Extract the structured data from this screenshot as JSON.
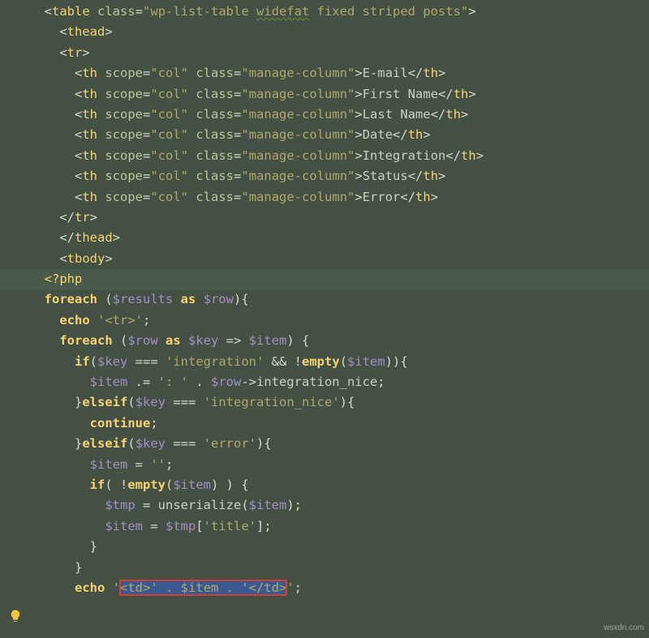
{
  "watermark": "wsxdn.com",
  "highlighted_line_index": 13,
  "selection": {
    "line_index": 28,
    "text": "<td>' . $item . '</td>"
  },
  "code_lines": [
    {
      "indent": 1,
      "tokens": [
        {
          "t": "punc",
          "v": "<"
        },
        {
          "t": "tag",
          "v": "table "
        },
        {
          "t": "attr",
          "v": "class"
        },
        {
          "t": "punc",
          "v": "="
        },
        {
          "t": "str",
          "v": "\"wp-list-table "
        },
        {
          "t": "str wavy",
          "v": "widefat"
        },
        {
          "t": "str",
          "v": " fixed striped posts\""
        },
        {
          "t": "punc",
          "v": ">"
        }
      ]
    },
    {
      "indent": 2,
      "tokens": [
        {
          "t": "punc",
          "v": "<"
        },
        {
          "t": "tag",
          "v": "thead"
        },
        {
          "t": "punc",
          "v": ">"
        }
      ]
    },
    {
      "indent": 2,
      "tokens": [
        {
          "t": "punc",
          "v": "<"
        },
        {
          "t": "tag",
          "v": "tr"
        },
        {
          "t": "punc",
          "v": ">"
        }
      ]
    },
    {
      "indent": 3,
      "tokens": [
        {
          "t": "punc",
          "v": "<"
        },
        {
          "t": "tag",
          "v": "th "
        },
        {
          "t": "attr",
          "v": "scope"
        },
        {
          "t": "punc",
          "v": "="
        },
        {
          "t": "str",
          "v": "\"col\" "
        },
        {
          "t": "attr",
          "v": "class"
        },
        {
          "t": "punc",
          "v": "="
        },
        {
          "t": "str",
          "v": "\"manage-column\""
        },
        {
          "t": "punc",
          "v": ">"
        },
        {
          "t": "txt",
          "v": "E-mail"
        },
        {
          "t": "punc",
          "v": "</"
        },
        {
          "t": "tag",
          "v": "th"
        },
        {
          "t": "punc",
          "v": ">"
        }
      ]
    },
    {
      "indent": 3,
      "tokens": [
        {
          "t": "punc",
          "v": "<"
        },
        {
          "t": "tag",
          "v": "th "
        },
        {
          "t": "attr",
          "v": "scope"
        },
        {
          "t": "punc",
          "v": "="
        },
        {
          "t": "str",
          "v": "\"col\" "
        },
        {
          "t": "attr",
          "v": "class"
        },
        {
          "t": "punc",
          "v": "="
        },
        {
          "t": "str",
          "v": "\"manage-column\""
        },
        {
          "t": "punc",
          "v": ">"
        },
        {
          "t": "txt",
          "v": "First Name"
        },
        {
          "t": "punc",
          "v": "</"
        },
        {
          "t": "tag",
          "v": "th"
        },
        {
          "t": "punc",
          "v": ">"
        }
      ]
    },
    {
      "indent": 3,
      "tokens": [
        {
          "t": "punc",
          "v": "<"
        },
        {
          "t": "tag",
          "v": "th "
        },
        {
          "t": "attr",
          "v": "scope"
        },
        {
          "t": "punc",
          "v": "="
        },
        {
          "t": "str",
          "v": "\"col\" "
        },
        {
          "t": "attr",
          "v": "class"
        },
        {
          "t": "punc",
          "v": "="
        },
        {
          "t": "str",
          "v": "\"manage-column\""
        },
        {
          "t": "punc",
          "v": ">"
        },
        {
          "t": "txt",
          "v": "Last Name"
        },
        {
          "t": "punc",
          "v": "</"
        },
        {
          "t": "tag",
          "v": "th"
        },
        {
          "t": "punc",
          "v": ">"
        }
      ]
    },
    {
      "indent": 3,
      "tokens": [
        {
          "t": "punc",
          "v": "<"
        },
        {
          "t": "tag",
          "v": "th "
        },
        {
          "t": "attr",
          "v": "scope"
        },
        {
          "t": "punc",
          "v": "="
        },
        {
          "t": "str",
          "v": "\"col\" "
        },
        {
          "t": "attr",
          "v": "class"
        },
        {
          "t": "punc",
          "v": "="
        },
        {
          "t": "str",
          "v": "\"manage-column\""
        },
        {
          "t": "punc",
          "v": ">"
        },
        {
          "t": "txt",
          "v": "Date"
        },
        {
          "t": "punc",
          "v": "</"
        },
        {
          "t": "tag",
          "v": "th"
        },
        {
          "t": "punc",
          "v": ">"
        }
      ]
    },
    {
      "indent": 3,
      "tokens": [
        {
          "t": "punc",
          "v": "<"
        },
        {
          "t": "tag",
          "v": "th "
        },
        {
          "t": "attr",
          "v": "scope"
        },
        {
          "t": "punc",
          "v": "="
        },
        {
          "t": "str",
          "v": "\"col\" "
        },
        {
          "t": "attr",
          "v": "class"
        },
        {
          "t": "punc",
          "v": "="
        },
        {
          "t": "str",
          "v": "\"manage-column\""
        },
        {
          "t": "punc",
          "v": ">"
        },
        {
          "t": "txt",
          "v": "Integration"
        },
        {
          "t": "punc",
          "v": "</"
        },
        {
          "t": "tag",
          "v": "th"
        },
        {
          "t": "punc",
          "v": ">"
        }
      ]
    },
    {
      "indent": 3,
      "tokens": [
        {
          "t": "punc",
          "v": "<"
        },
        {
          "t": "tag",
          "v": "th "
        },
        {
          "t": "attr",
          "v": "scope"
        },
        {
          "t": "punc",
          "v": "="
        },
        {
          "t": "str",
          "v": "\"col\" "
        },
        {
          "t": "attr",
          "v": "class"
        },
        {
          "t": "punc",
          "v": "="
        },
        {
          "t": "str",
          "v": "\"manage-column\""
        },
        {
          "t": "punc",
          "v": ">"
        },
        {
          "t": "txt",
          "v": "Status"
        },
        {
          "t": "punc",
          "v": "</"
        },
        {
          "t": "tag",
          "v": "th"
        },
        {
          "t": "punc",
          "v": ">"
        }
      ]
    },
    {
      "indent": 3,
      "tokens": [
        {
          "t": "punc",
          "v": "<"
        },
        {
          "t": "tag",
          "v": "th "
        },
        {
          "t": "attr",
          "v": "scope"
        },
        {
          "t": "punc",
          "v": "="
        },
        {
          "t": "str",
          "v": "\"col\" "
        },
        {
          "t": "attr",
          "v": "class"
        },
        {
          "t": "punc",
          "v": "="
        },
        {
          "t": "str",
          "v": "\"manage-column\""
        },
        {
          "t": "punc",
          "v": ">"
        },
        {
          "t": "txt",
          "v": "Error"
        },
        {
          "t": "punc",
          "v": "</"
        },
        {
          "t": "tag",
          "v": "th"
        },
        {
          "t": "punc",
          "v": ">"
        }
      ]
    },
    {
      "indent": 2,
      "tokens": [
        {
          "t": "punc",
          "v": "</"
        },
        {
          "t": "tag",
          "v": "tr"
        },
        {
          "t": "punc",
          "v": ">"
        }
      ]
    },
    {
      "indent": 2,
      "tokens": [
        {
          "t": "punc",
          "v": "</"
        },
        {
          "t": "tag",
          "v": "thead"
        },
        {
          "t": "punc",
          "v": ">"
        }
      ]
    },
    {
      "indent": 2,
      "tokens": [
        {
          "t": "punc",
          "v": "<"
        },
        {
          "t": "tag",
          "v": "tbody"
        },
        {
          "t": "punc",
          "v": ">"
        }
      ]
    },
    {
      "indent": 1,
      "tokens": [
        {
          "t": "kwp",
          "v": "<?php"
        }
      ]
    },
    {
      "indent": 1,
      "tokens": [
        {
          "t": "kw",
          "v": "foreach"
        },
        {
          "t": "op",
          "v": " ("
        },
        {
          "t": "var",
          "v": "$results"
        },
        {
          "t": "op",
          "v": " "
        },
        {
          "t": "kw",
          "v": "as"
        },
        {
          "t": "op",
          "v": " "
        },
        {
          "t": "var",
          "v": "$row"
        },
        {
          "t": "op",
          "v": "){"
        }
      ]
    },
    {
      "indent": 2,
      "tokens": [
        {
          "t": "kw",
          "v": "echo"
        },
        {
          "t": "op",
          "v": " "
        },
        {
          "t": "str",
          "v": "'<tr>'"
        },
        {
          "t": "op",
          "v": ";"
        }
      ]
    },
    {
      "indent": 2,
      "tokens": [
        {
          "t": "kw",
          "v": "foreach"
        },
        {
          "t": "op",
          "v": " ("
        },
        {
          "t": "var",
          "v": "$row"
        },
        {
          "t": "op",
          "v": " "
        },
        {
          "t": "kw",
          "v": "as"
        },
        {
          "t": "op",
          "v": " "
        },
        {
          "t": "var",
          "v": "$key"
        },
        {
          "t": "op",
          "v": " => "
        },
        {
          "t": "var",
          "v": "$item"
        },
        {
          "t": "op",
          "v": ") {"
        }
      ]
    },
    {
      "indent": 3,
      "tokens": [
        {
          "t": "kw",
          "v": "if"
        },
        {
          "t": "op",
          "v": "("
        },
        {
          "t": "var",
          "v": "$key"
        },
        {
          "t": "op",
          "v": " === "
        },
        {
          "t": "str",
          "v": "'integration'"
        },
        {
          "t": "op",
          "v": " && !"
        },
        {
          "t": "kw",
          "v": "empty"
        },
        {
          "t": "op",
          "v": "("
        },
        {
          "t": "var",
          "v": "$item"
        },
        {
          "t": "op",
          "v": ")){"
        }
      ]
    },
    {
      "indent": 4,
      "tokens": [
        {
          "t": "var",
          "v": "$item"
        },
        {
          "t": "op",
          "v": " .= "
        },
        {
          "t": "str",
          "v": "': '"
        },
        {
          "t": "op",
          "v": " . "
        },
        {
          "t": "var",
          "v": "$row"
        },
        {
          "t": "op",
          "v": "->"
        },
        {
          "t": "fn",
          "v": "integration_nice"
        },
        {
          "t": "op",
          "v": ";"
        }
      ]
    },
    {
      "indent": 3,
      "tokens": [
        {
          "t": "op",
          "v": "}"
        },
        {
          "t": "kw",
          "v": "elseif"
        },
        {
          "t": "op",
          "v": "("
        },
        {
          "t": "var",
          "v": "$key"
        },
        {
          "t": "op",
          "v": " === "
        },
        {
          "t": "str",
          "v": "'integration_nice'"
        },
        {
          "t": "op",
          "v": "){"
        }
      ]
    },
    {
      "indent": 4,
      "tokens": [
        {
          "t": "kw",
          "v": "continue"
        },
        {
          "t": "op",
          "v": ";"
        }
      ]
    },
    {
      "indent": 3,
      "tokens": [
        {
          "t": "op",
          "v": "}"
        },
        {
          "t": "kw",
          "v": "elseif"
        },
        {
          "t": "op",
          "v": "("
        },
        {
          "t": "var",
          "v": "$key"
        },
        {
          "t": "op",
          "v": " === "
        },
        {
          "t": "str",
          "v": "'error'"
        },
        {
          "t": "op",
          "v": "){"
        }
      ]
    },
    {
      "indent": 4,
      "tokens": [
        {
          "t": "var",
          "v": "$item"
        },
        {
          "t": "op",
          "v": " = "
        },
        {
          "t": "str",
          "v": "''"
        },
        {
          "t": "op",
          "v": ";"
        }
      ]
    },
    {
      "indent": 4,
      "tokens": [
        {
          "t": "kw",
          "v": "if"
        },
        {
          "t": "op",
          "v": "( !"
        },
        {
          "t": "kw",
          "v": "empty"
        },
        {
          "t": "op",
          "v": "("
        },
        {
          "t": "var",
          "v": "$item"
        },
        {
          "t": "op",
          "v": ") ) {"
        }
      ]
    },
    {
      "indent": 5,
      "tokens": [
        {
          "t": "var",
          "v": "$tmp"
        },
        {
          "t": "op",
          "v": " = "
        },
        {
          "t": "fn",
          "v": "unserialize"
        },
        {
          "t": "op",
          "v": "("
        },
        {
          "t": "var",
          "v": "$item"
        },
        {
          "t": "op",
          "v": ");"
        }
      ]
    },
    {
      "indent": 5,
      "tokens": [
        {
          "t": "var",
          "v": "$item"
        },
        {
          "t": "op",
          "v": " = "
        },
        {
          "t": "var",
          "v": "$tmp"
        },
        {
          "t": "op",
          "v": "["
        },
        {
          "t": "str",
          "v": "'title'"
        },
        {
          "t": "op",
          "v": "];"
        }
      ]
    },
    {
      "indent": 4,
      "tokens": [
        {
          "t": "op",
          "v": "}"
        }
      ]
    },
    {
      "indent": 3,
      "tokens": [
        {
          "t": "op",
          "v": "}"
        }
      ]
    },
    {
      "indent": 3,
      "tokens": [
        {
          "t": "kw",
          "v": "echo"
        },
        {
          "t": "op",
          "v": " "
        },
        {
          "t": "str",
          "v": "'"
        },
        {
          "t": "sel str",
          "v": "<td>' . $item . '</td>"
        },
        {
          "t": "str",
          "v": "'"
        },
        {
          "t": "op",
          "v": ";"
        }
      ]
    }
  ]
}
